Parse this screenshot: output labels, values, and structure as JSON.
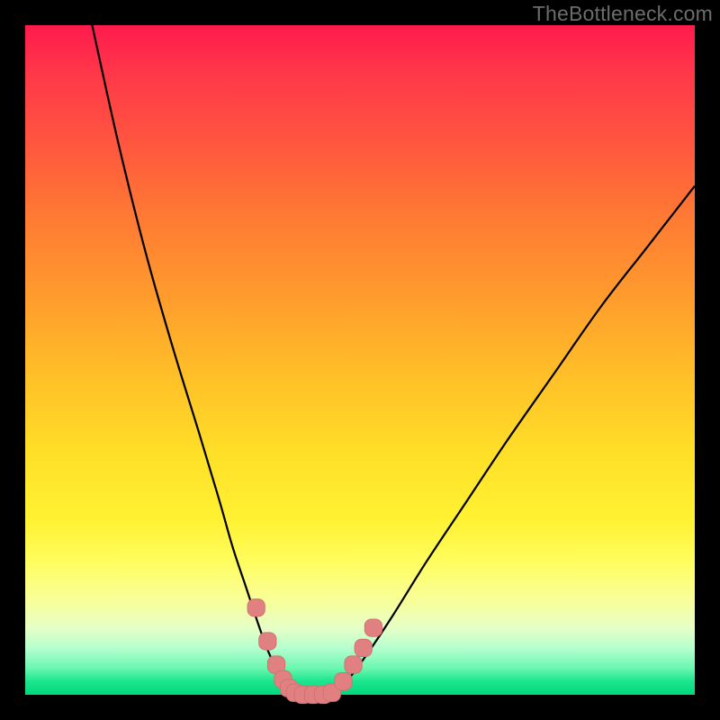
{
  "watermark": {
    "text": "TheBottleneck.com"
  },
  "colors": {
    "frame": "#000000",
    "curve_stroke": "#000000",
    "marker_fill": "#e08080",
    "marker_stroke": "#d07070",
    "gradient_top": "#ff1a4d",
    "gradient_bottom": "#00d87d"
  },
  "chart_data": {
    "type": "line",
    "title": "",
    "xlabel": "",
    "ylabel": "",
    "xlim": [
      0,
      100
    ],
    "ylim": [
      0,
      100
    ],
    "grid": false,
    "legend": false,
    "description": "Two smooth curves descending from top-left and top-right into a shared valley near the bottom; y-axis inverted (0 at top, 100 at bottom).",
    "series": [
      {
        "name": "left-curve",
        "x": [
          10,
          14,
          18,
          22,
          26,
          29,
          31,
          33,
          35,
          36.5,
          38,
          39,
          40
        ],
        "y": [
          0,
          18,
          34,
          48,
          61,
          71,
          78,
          84,
          90,
          94,
          97,
          99,
          100
        ]
      },
      {
        "name": "right-curve",
        "x": [
          46,
          48,
          51,
          55,
          60,
          66,
          72,
          79,
          86,
          93,
          100
        ],
        "y": [
          100,
          98,
          94,
          88,
          80,
          71,
          62,
          52,
          42,
          33,
          24
        ]
      },
      {
        "name": "valley-floor",
        "x": [
          40,
          43,
          46
        ],
        "y": [
          100,
          100,
          100
        ]
      }
    ],
    "markers": [
      {
        "series": "left-curve",
        "x": 34.5,
        "y": 87
      },
      {
        "series": "left-curve",
        "x": 36.2,
        "y": 92
      },
      {
        "series": "left-curve",
        "x": 37.5,
        "y": 95.5
      },
      {
        "series": "left-curve",
        "x": 38.5,
        "y": 97.7
      },
      {
        "series": "left-curve",
        "x": 39.4,
        "y": 99
      },
      {
        "series": "valley-floor",
        "x": 40.3,
        "y": 99.7
      },
      {
        "series": "valley-floor",
        "x": 41.5,
        "y": 100
      },
      {
        "series": "valley-floor",
        "x": 43.0,
        "y": 100
      },
      {
        "series": "valley-floor",
        "x": 44.5,
        "y": 100
      },
      {
        "series": "valley-floor",
        "x": 45.8,
        "y": 99.7
      },
      {
        "series": "right-curve",
        "x": 47.5,
        "y": 98
      },
      {
        "series": "right-curve",
        "x": 49.0,
        "y": 95.5
      },
      {
        "series": "right-curve",
        "x": 50.5,
        "y": 93
      },
      {
        "series": "right-curve",
        "x": 52.0,
        "y": 90
      }
    ]
  }
}
